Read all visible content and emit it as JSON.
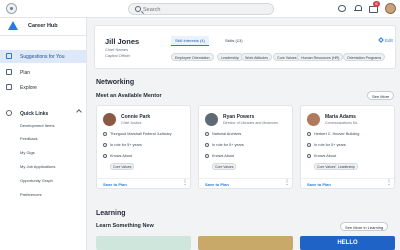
{
  "topbar": {
    "search_placeholder": "Search",
    "inbox_badge": "6"
  },
  "sidebar": {
    "app_title": "Career Hub",
    "items": [
      {
        "label": "Suggestions for You"
      },
      {
        "label": "Plan"
      },
      {
        "label": "Explore"
      }
    ],
    "quick_links": {
      "label": "Quick Links",
      "links": [
        "Development Items",
        "Feedback",
        "My Gigs",
        "My Job Applications",
        "Opportunity Graph",
        "Preferences"
      ]
    }
  },
  "profile": {
    "name": "Jill Jones",
    "title": "Chief Names",
    "org": "Capital Officer",
    "tabs": [
      "Skill Interests (4)",
      "Skills (13)"
    ],
    "chips": [
      "Employee Orientation",
      "Leadership",
      "Work Attitudes",
      "Core Values",
      "Human Resources (HR)",
      "Orientation Programs"
    ],
    "edit_label": "Edit"
  },
  "networking": {
    "title": "Networking",
    "subtitle": "Meet an Available Mentor",
    "see_more": "See More",
    "mentors": [
      {
        "name": "Connie Park",
        "role": "Chief Justice",
        "location": "Thurgood Marshall Federal Judiciary",
        "tenure": "In role for 5+ years",
        "knows": "Knows About",
        "chips": [
          "Core Values"
        ],
        "save": "Save to Plan"
      },
      {
        "name": "Ryan Powers",
        "role": "Director of Libraries and Museums",
        "location": "National Archives",
        "tenure": "In role for 5+ years",
        "knows": "Knows About",
        "chips": [
          "Core Values"
        ],
        "save": "Save to Plan"
      },
      {
        "name": "Maria Adams",
        "role": "Communications Dir.",
        "location": "Herbert C. Hoover Building",
        "tenure": "In role for 5+ years",
        "knows": "Knows About",
        "chips": [
          "Core Values",
          "Leadership"
        ],
        "save": "Save to Plan"
      }
    ]
  },
  "learning": {
    "title": "Learning",
    "subtitle": "Learn Something New",
    "see_more": "See More in Learning",
    "banner_text": "HELLO"
  },
  "colors": {
    "accent": "#2a7bd6",
    "active_nav_bg": "#dde9f8",
    "badge": "#d64545"
  }
}
